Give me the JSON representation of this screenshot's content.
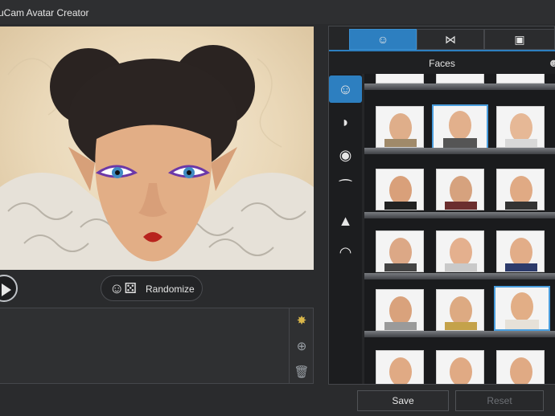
{
  "window": {
    "title": "uCam Avatar Creator"
  },
  "controls": {
    "randomize_label": "Randomize"
  },
  "panel": {
    "tabs": [
      {
        "icon": "face-edit-icon",
        "active": true
      },
      {
        "icon": "bowtie-icon",
        "active": false
      },
      {
        "icon": "landscape-icon",
        "active": false
      }
    ],
    "section_title": "Faces",
    "categories": [
      "face-icon",
      "hair-icon",
      "eye-icon",
      "eyebrows-icon",
      "nose-icon",
      "lips-icon"
    ],
    "selected_thumbnails": 2
  },
  "footer": {
    "save_label": "Save",
    "reset_label": "Reset"
  },
  "colors": {
    "accent": "#2d7fc0",
    "background": "#2a2b2d"
  }
}
